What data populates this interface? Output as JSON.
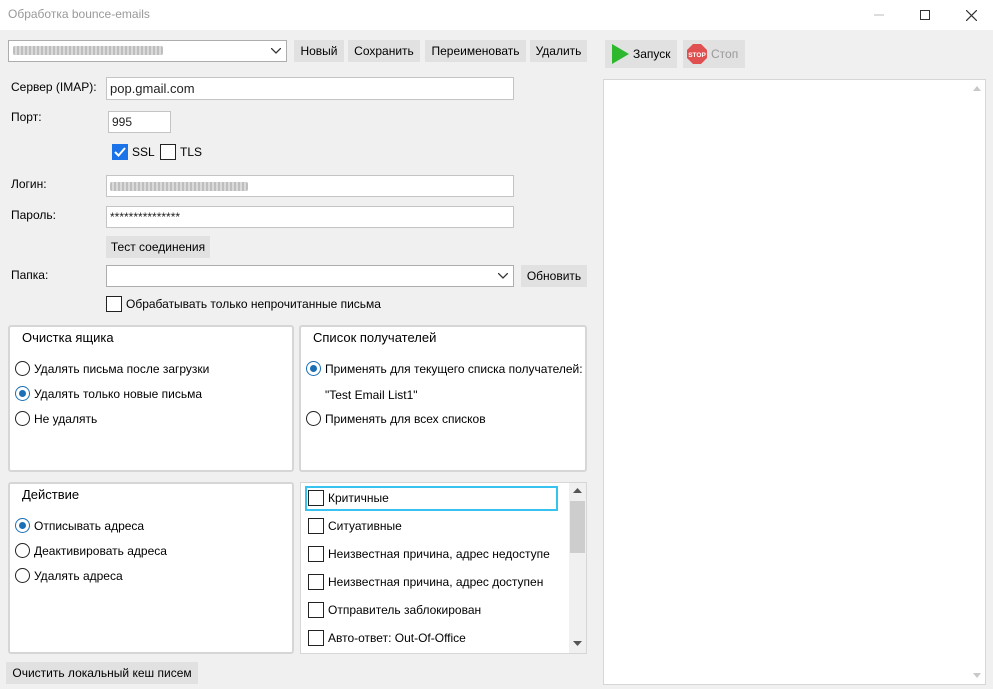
{
  "window": {
    "title": "Обработка bounce-emails",
    "controls": [
      "minimize",
      "maximize",
      "close"
    ]
  },
  "toolbar": {
    "account_value": "",
    "new_label": "Новый",
    "save_label": "Сохранить",
    "rename_label": "Переименовать",
    "delete_label": "Удалить",
    "start_label": "Запуск",
    "stop_label": "Стоп",
    "stop_icon_text": "STOP"
  },
  "form": {
    "server_label": "Сервер (IMAP):",
    "server_value": "pop.gmail.com",
    "port_label": "Порт:",
    "port_value": "995",
    "ssl_label": "SSL",
    "ssl_checked": true,
    "tls_label": "TLS",
    "tls_checked": false,
    "login_label": "Логин:",
    "password_label": "Пароль:",
    "password_value": "***************",
    "test_label": "Тест соединения",
    "folder_label": "Папка:",
    "folder_value": "",
    "refresh_label": "Обновить",
    "unread_only_label": "Обрабатывать только непрочитанные письма",
    "unread_only_checked": false
  },
  "mailbox_cleanup": {
    "title": "Очистка ящика",
    "options": [
      {
        "label": "Удалять письма после загрузки",
        "checked": false
      },
      {
        "label": "Удалять только новые письма",
        "checked": true
      },
      {
        "label": "Не удалять",
        "checked": false
      }
    ]
  },
  "recipients": {
    "title": "Список получателей",
    "options": [
      {
        "label": "Применять для текущего списка получателей:",
        "checked": true
      },
      {
        "label": "Применять для всех списков",
        "checked": false
      }
    ],
    "current_list": "\"Test Email List1\""
  },
  "action": {
    "title": "Действие",
    "options": [
      {
        "label": "Отписывать адреса",
        "checked": true
      },
      {
        "label": "Деактивировать адреса",
        "checked": false
      },
      {
        "label": "Удалять адреса",
        "checked": false
      }
    ]
  },
  "categories": [
    {
      "label": "Критичные",
      "checked": false
    },
    {
      "label": "Ситуативные",
      "checked": false
    },
    {
      "label": "Неизвестная причина, адрес недоступе",
      "checked": false
    },
    {
      "label": "Неизвестная причина, адрес доступен",
      "checked": false
    },
    {
      "label": "Отправитель заблокирован",
      "checked": false
    },
    {
      "label": "Авто-ответ: Out-Of-Office",
      "checked": false
    }
  ],
  "footer": {
    "clear_cache_label": "Очистить локальный кеш писем"
  },
  "colors": {
    "accent": "#1a73e8",
    "focus": "#36c3f0",
    "start_green": "#2eb82e",
    "stop_red": "#e04040"
  }
}
